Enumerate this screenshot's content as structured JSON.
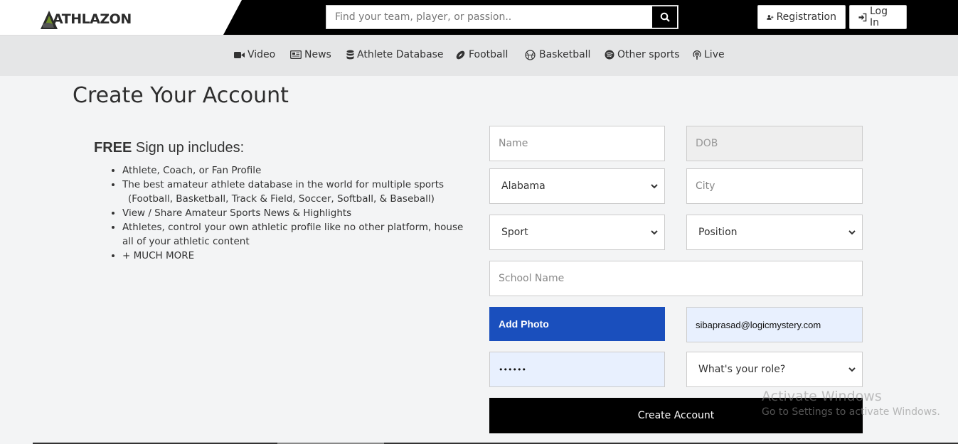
{
  "header": {
    "logo_text": "ATHLAZON",
    "search_placeholder": "Find your team, player, or passion..",
    "registration_label": "Registration",
    "login_label": "Log In"
  },
  "nav": {
    "items": [
      {
        "label": "Video",
        "icon": "video-camera-icon"
      },
      {
        "label": "News",
        "icon": "newspaper-icon"
      },
      {
        "label": "Athlete Database",
        "icon": "database-icon"
      },
      {
        "label": "Football",
        "icon": "football-icon"
      },
      {
        "label": "Basketball",
        "icon": "basketball-icon"
      },
      {
        "label": "Other sports",
        "icon": "spotify-icon"
      },
      {
        "label": "Live",
        "icon": "podcast-icon"
      }
    ]
  },
  "page": {
    "title": "Create Your Account",
    "signup_heading_bold": "FREE",
    "signup_heading_rest": " Sign up includes:",
    "benefits": [
      "Athlete, Coach, or Fan Profile",
      "The best amateur athlete database in the world for multiple sports",
      "(Football, Basketball, Track & Field, Soccer, Softball, & Baseball)",
      "View / Share Amateur Sports News & Highlights",
      "Athletes, control your own athletic profile like no other platform, house all of your athletic content",
      "+ MUCH MORE"
    ]
  },
  "form": {
    "name_placeholder": "Name",
    "dob_placeholder": "DOB",
    "state_value": "Alabama",
    "city_placeholder": "City",
    "sport_value": "Sport",
    "position_value": "Position",
    "school_placeholder": "School Name",
    "add_photo_label": "Add Photo",
    "email_value": "sibaprasad@logicmystery.com",
    "password_value": "••••••",
    "role_value": "What's your role?",
    "submit_label": "Create Account"
  },
  "overlay": {
    "activate_title": "Activate Windows",
    "activate_sub": "Go to Settings to activate Windows."
  },
  "colors": {
    "header_bg": "#000000",
    "add_photo_bg": "#1a4fbd",
    "autofill_bg": "#e8f0fe"
  }
}
